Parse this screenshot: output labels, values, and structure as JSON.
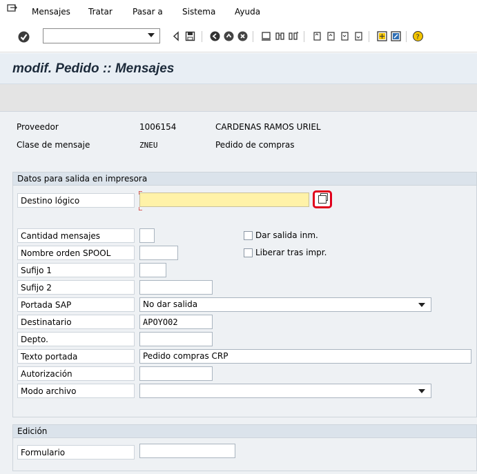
{
  "menu": {
    "items": [
      "Mensajes",
      "Tratar",
      "Pasar a",
      "Sistema",
      "Ayuda"
    ]
  },
  "toolbar": {
    "command_field_value": "",
    "icons": [
      "enter-icon",
      "back-icon",
      "save-icon",
      "go-back-icon",
      "exit-icon",
      "cancel-icon",
      "print-icon",
      "find-icon",
      "find-next-icon",
      "first-page-icon",
      "previous-page-icon",
      "next-page-icon",
      "last-page-icon",
      "create-session-icon",
      "shortcut-icon",
      "help-icon"
    ]
  },
  "title": "modif. Pedido :: Mensajes",
  "header": {
    "vendor_label": "Proveedor",
    "vendor_number": "1006154",
    "vendor_name": "CARDENAS RAMOS URIEL",
    "msg_type_label": "Clase de mensaje",
    "msg_type_code": "ZNEU",
    "msg_type_desc": "Pedido de compras"
  },
  "printer_group": {
    "title": "Datos para salida en impresora",
    "logical_dest_label": "Destino lógico",
    "logical_dest_value": "",
    "num_messages_label": "Cantidad mensajes",
    "num_messages_value": "",
    "spool_name_label": "Nombre orden SPOOL",
    "spool_name_value": "",
    "suffix1_label": "Sufijo 1",
    "suffix1_value": "",
    "suffix2_label": "Sufijo 2",
    "suffix2_value": "",
    "cover_label": "Portada SAP",
    "cover_value": "No dar salida",
    "recipient_label": "Destinatario",
    "recipient_value": "APOYO02",
    "dept_label": "Depto.",
    "dept_value": "",
    "cover_text_label": "Texto portada",
    "cover_text_value": "Pedido compras CRP",
    "auth_label": "Autorización",
    "auth_value": "",
    "archive_mode_label": "Modo archivo",
    "archive_mode_value": "",
    "print_immediately_label": "Dar salida inm.",
    "print_immediately_checked": false,
    "release_after_print_label": "Liberar tras impr.",
    "release_after_print_checked": false
  },
  "edition_group": {
    "title": "Edición",
    "form_label": "Formulario",
    "form_value": ""
  },
  "colors": {
    "required_field": "#fff2a8",
    "highlight_border": "#e0001b",
    "title_bar": "#e8eef4",
    "content_bg": "#eef1f4"
  }
}
